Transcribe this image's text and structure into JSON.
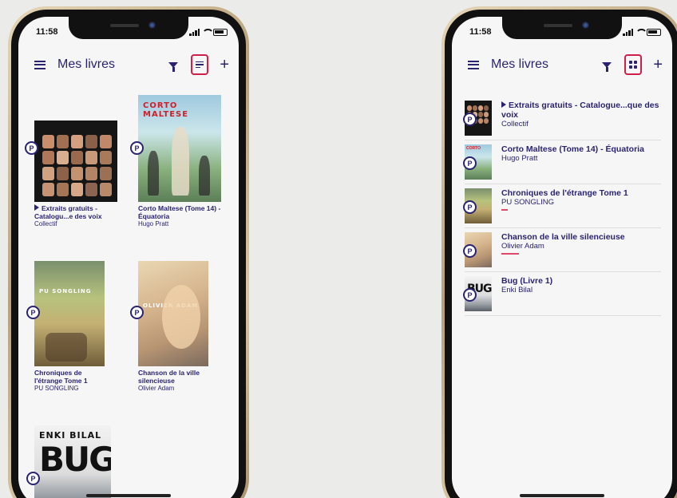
{
  "status": {
    "time": "11:58"
  },
  "app": {
    "title": "Mes livres"
  },
  "icons": {
    "menu": "hamburger-icon",
    "filter": "filter-icon",
    "list_view": "list-view-icon",
    "grid_view": "grid-view-icon",
    "add": "plus-icon",
    "badge": "P"
  },
  "accent_color": "#d01f4a",
  "grid_screen": {
    "books": [
      {
        "cover_title": "",
        "title": "Extraits gratuits - Catalogu...e des voix",
        "author": "Collectif",
        "has_play": true
      },
      {
        "cover_title": "CORTO MALTESE",
        "title": "Corto Maltese (Tome 14) - Équatoria",
        "author": "Hugo Pratt",
        "has_play": false
      },
      {
        "cover_title": "PU SONGLING",
        "title": "Chroniques de l'étrange Tome 1",
        "author": "PU SONGLING",
        "has_play": false
      },
      {
        "cover_title": "OLIVIER ADAM",
        "title": "Chanson de la ville silencieuse",
        "author": "Olivier Adam",
        "has_play": false
      },
      {
        "cover_title": "ENKI BILAL",
        "cover_big": "BUG",
        "title": "",
        "author": "",
        "has_play": false
      }
    ]
  },
  "list_screen": {
    "books": [
      {
        "title": "Extraits gratuits - Catalogue...que des voix",
        "author": "Collectif",
        "has_play": true,
        "progress": 0
      },
      {
        "title": "Corto Maltese (Tome 14) - Équatoria",
        "author": "Hugo Pratt",
        "has_play": false,
        "progress": 0
      },
      {
        "title": "Chroniques de l'étrange Tome 1",
        "author": "PU SONGLING",
        "has_play": false,
        "progress": 0.1
      },
      {
        "title": "Chanson de la ville silencieuse",
        "author": "Olivier Adam",
        "has_play": false,
        "progress": 0.15
      },
      {
        "title": "Bug (Livre 1)",
        "author": "Enki Bilal",
        "has_play": false,
        "progress": 0
      }
    ]
  }
}
